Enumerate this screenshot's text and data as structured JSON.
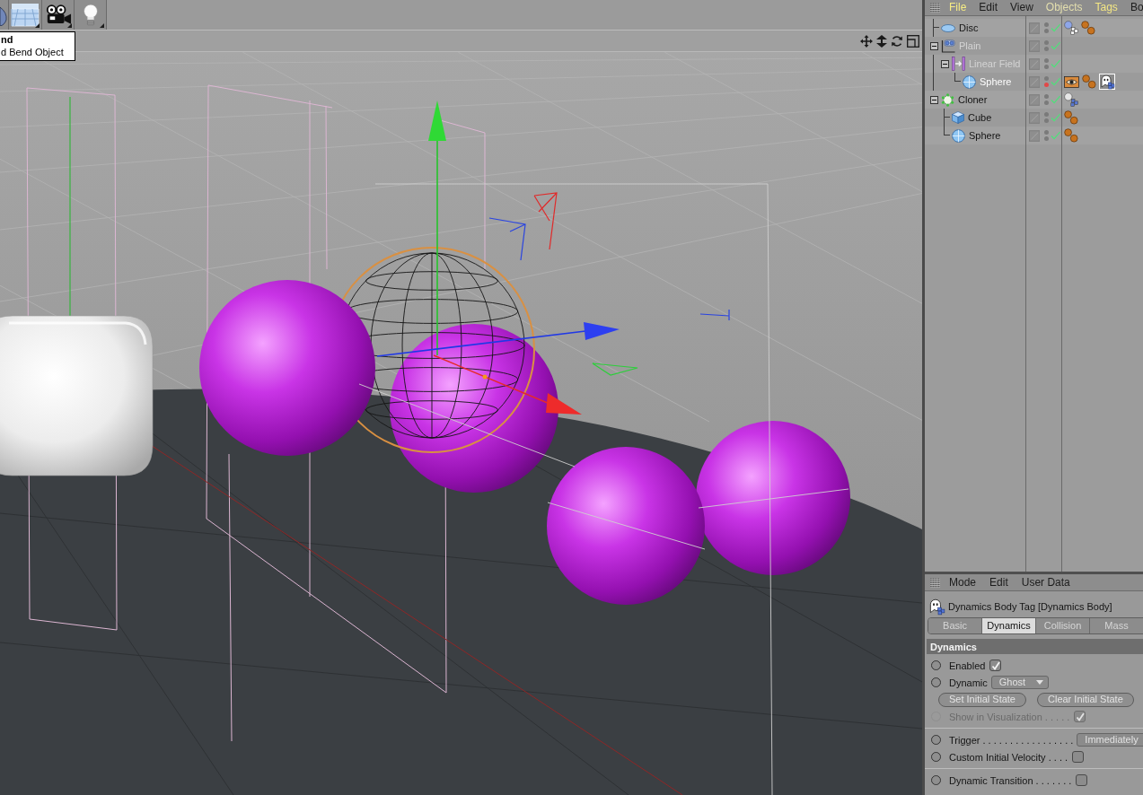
{
  "tooltip": {
    "title": "nd",
    "text": "d Bend Object"
  },
  "object_manager": {
    "menu": [
      {
        "label": "File",
        "color": "#f6ec84"
      },
      {
        "label": "Edit",
        "color": "#1c1c1c"
      },
      {
        "label": "View",
        "color": "#1c1c1c"
      },
      {
        "label": "Objects",
        "color": "#e4dfae"
      },
      {
        "label": "Tags",
        "color": "#f3e684"
      },
      {
        "label": "Bo",
        "color": "#1c1c1c"
      }
    ],
    "objects": [
      {
        "name": "Disc",
        "kind": "disc",
        "selected": false,
        "dimmed": false,
        "enabled": true,
        "render_off": false,
        "tags": [
          {
            "kind": "collider",
            "selected": false
          },
          {
            "kind": "material",
            "selected": false
          }
        ]
      },
      {
        "name": "Plain",
        "kind": "plain",
        "selected": false,
        "dimmed": true,
        "enabled": true,
        "render_off": false,
        "expanded": true,
        "children": [
          {
            "name": "Linear Field",
            "kind": "linear-field",
            "selected": false,
            "dimmed": true,
            "enabled": true,
            "render_off": false,
            "expanded": true,
            "children": [
              {
                "name": "Sphere",
                "kind": "sphere",
                "selected": true,
                "dimmed": false,
                "enabled": true,
                "render_off": true,
                "tags": [
                  {
                    "kind": "display",
                    "selected": false
                  },
                  {
                    "kind": "material",
                    "selected": false
                  },
                  {
                    "kind": "dynamics",
                    "selected": true
                  }
                ]
              }
            ]
          }
        ]
      },
      {
        "name": "Cloner",
        "kind": "cloner",
        "selected": false,
        "dimmed": false,
        "enabled": true,
        "render_off": false,
        "expanded": true,
        "tags": [
          {
            "kind": "cluster",
            "selected": false
          }
        ],
        "children": [
          {
            "name": "Cube",
            "kind": "cube",
            "selected": false,
            "dimmed": false,
            "enabled": true,
            "render_off": false,
            "tags": [
              {
                "kind": "material",
                "selected": false
              }
            ]
          },
          {
            "name": "Sphere",
            "kind": "sphere",
            "selected": false,
            "dimmed": false,
            "enabled": true,
            "render_off": false,
            "tags": [
              {
                "kind": "material",
                "selected": false
              }
            ]
          }
        ]
      }
    ]
  },
  "attribute_manager": {
    "menu": [
      "Mode",
      "Edit",
      "User Data"
    ],
    "title": "Dynamics Body Tag [Dynamics Body]",
    "tabs": [
      {
        "label": "Basic",
        "selected": false
      },
      {
        "label": "Dynamics",
        "selected": true
      },
      {
        "label": "Collision",
        "selected": false
      },
      {
        "label": "Mass",
        "selected": false
      }
    ],
    "section": "Dynamics",
    "rows": [
      {
        "kind": "checkbox",
        "label": "Enabled",
        "checked": true,
        "disabled": false
      },
      {
        "kind": "dropdown",
        "label": "Dynamic",
        "value": "Ghost"
      },
      {
        "kind": "buttons",
        "buttons": [
          "Set Initial State",
          "Clear Initial State"
        ]
      },
      {
        "kind": "checkbox",
        "label": "Show in Visualization . . . . .",
        "checked": true,
        "disabled": true
      },
      {
        "kind": "divider"
      },
      {
        "kind": "dropdown",
        "label": "Trigger . . . . . . . . . . . . . . . . .",
        "value": "Immediately"
      },
      {
        "kind": "checkbox",
        "label": "Custom Initial Velocity . . . .",
        "checked": false,
        "disabled": false
      },
      {
        "kind": "divider"
      },
      {
        "kind": "checkbox",
        "label": "Dynamic Transition . . . . . . .",
        "checked": false,
        "disabled": false
      }
    ]
  }
}
